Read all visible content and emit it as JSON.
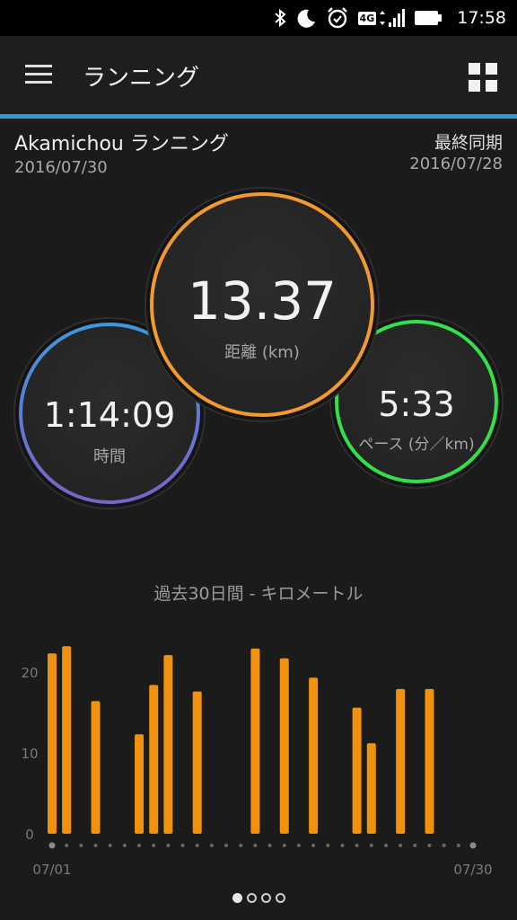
{
  "status_bar": {
    "time": "17:58",
    "network": "4G",
    "icons": [
      "bluetooth-icon",
      "do-not-disturb-moon-icon",
      "alarm-icon",
      "4g-signal-icon",
      "battery-icon"
    ]
  },
  "app_bar": {
    "title": "ランニング",
    "accent_color": "#2c9ad7"
  },
  "activity": {
    "name": "Akamichou ランニング",
    "date": "2016/07/30",
    "sync_label": "最終同期",
    "sync_date": "2016/07/28"
  },
  "metrics": {
    "distance": {
      "value": "13.37",
      "label": "距離 (km)",
      "color": "#f29a2e"
    },
    "time": {
      "value": "1:14:09",
      "label": "時間",
      "color_top": "#3d98e0",
      "color_bottom": "#7b63c6"
    },
    "pace": {
      "value": "5:33",
      "label": "ペース (分／km)",
      "color": "#32e04a"
    }
  },
  "chart_data": {
    "type": "bar",
    "title": "過去30日間 - キロメートル",
    "x_start_label": "07/01",
    "x_end_label": "07/30",
    "ytick_labels": [
      "0",
      "10",
      "20"
    ],
    "ylim": [
      0,
      25
    ],
    "bar_color": "#f0920e",
    "days": [
      1,
      2,
      3,
      4,
      5,
      6,
      7,
      8,
      9,
      10,
      11,
      12,
      13,
      14,
      15,
      16,
      17,
      18,
      19,
      20,
      21,
      22,
      23,
      24,
      25,
      26,
      27,
      28,
      29,
      30
    ],
    "values": [
      22.3,
      23.2,
      0,
      16.4,
      0,
      0,
      12.3,
      18.4,
      22.1,
      0,
      17.6,
      0,
      0,
      0,
      22.9,
      0,
      21.7,
      0,
      19.3,
      0,
      0,
      15.6,
      11.2,
      0,
      17.9,
      0,
      17.9,
      0,
      0,
      0
    ]
  },
  "pager": {
    "count": 4,
    "active": 0
  }
}
